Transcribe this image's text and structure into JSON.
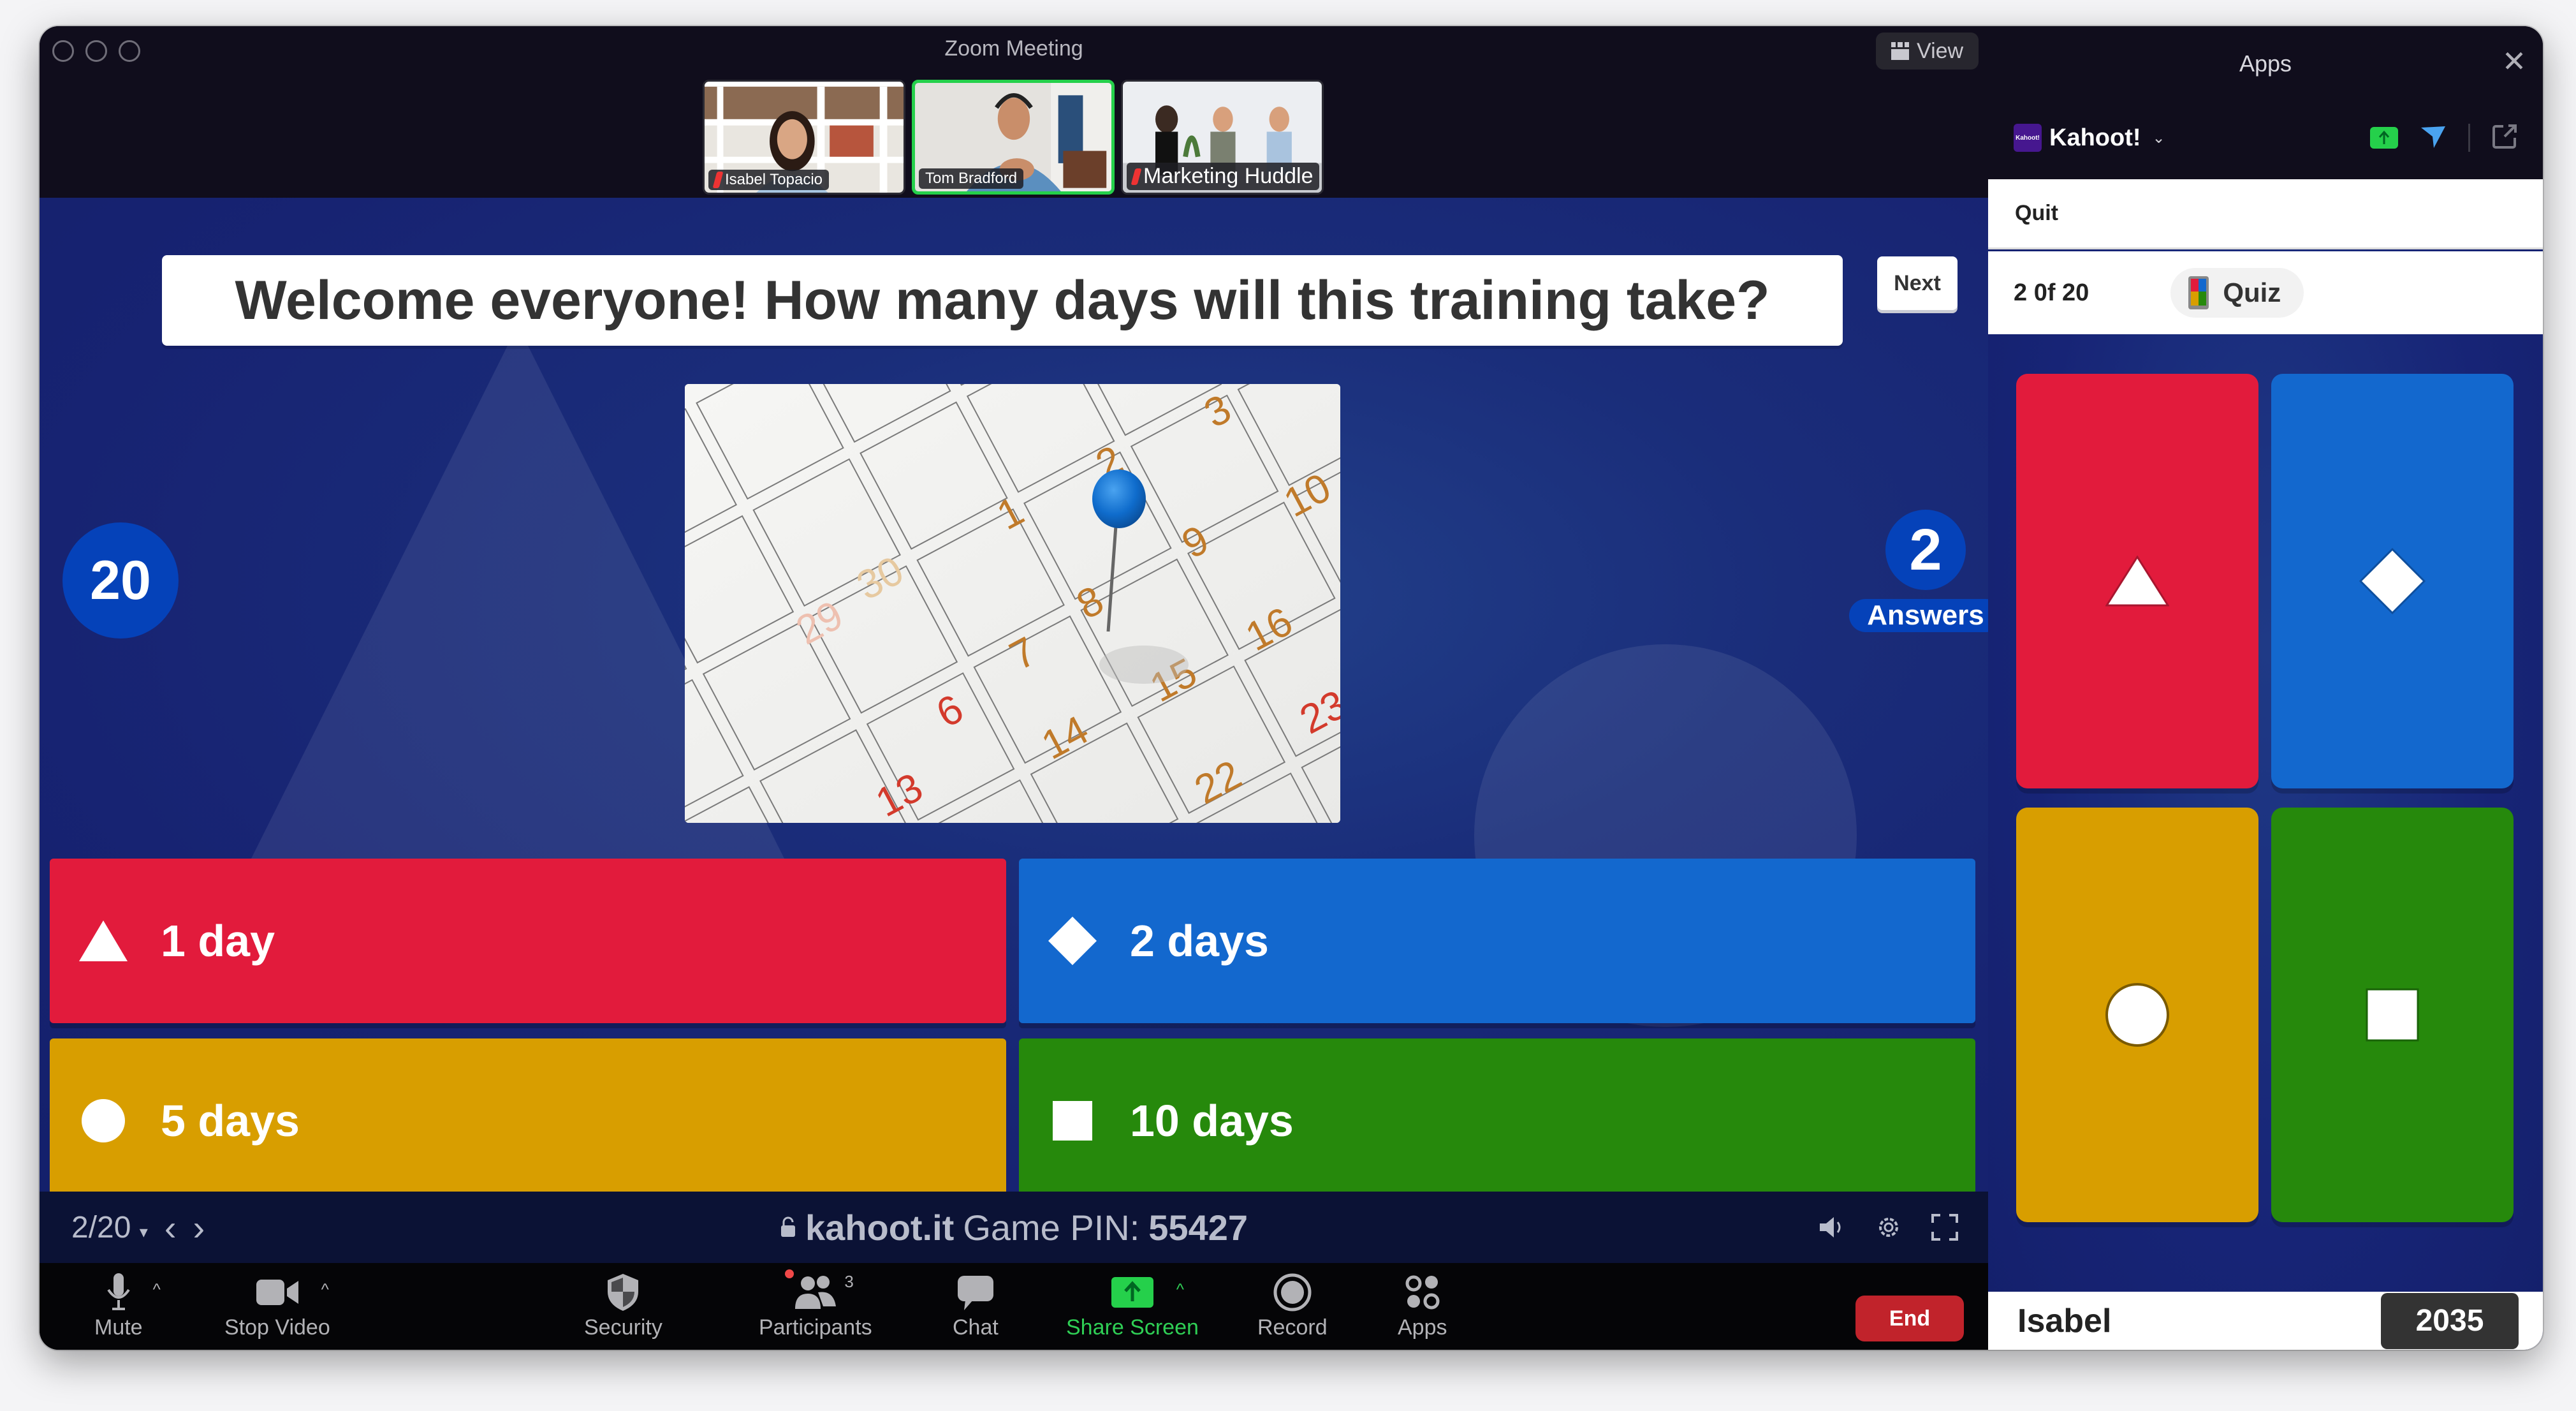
{
  "window": {
    "title": "Zoom Meeting",
    "view_button": "View"
  },
  "participants": [
    {
      "name": "Isabel Topacio",
      "muted": true,
      "active": false
    },
    {
      "name": "Tom Bradford",
      "muted": false,
      "active": true
    },
    {
      "name": "Marketing Huddle",
      "muted": true,
      "active": false
    }
  ],
  "kahoot": {
    "question": "Welcome everyone! How many days will this training take?",
    "next_label": "Next",
    "timer": "20",
    "answers_count": "2",
    "answers_label": "Answers",
    "image_alt": "calendar with blue push pin",
    "calendar_numbers": [
      "3",
      "2",
      "10",
      "1",
      "9",
      "30",
      "29",
      "8",
      "7",
      "16",
      "6",
      "15",
      "14",
      "23",
      "22",
      "13"
    ],
    "options": [
      {
        "shape": "triangle",
        "label": "1 day",
        "color": "#e21b3c"
      },
      {
        "shape": "diamond",
        "label": "2 days",
        "color": "#1368ce"
      },
      {
        "shape": "circle",
        "label": "5 days",
        "color": "#d89e00"
      },
      {
        "shape": "square",
        "label": "10 days",
        "color": "#26890c"
      }
    ],
    "footer": {
      "pager": "2/20",
      "site": "kahoot.it",
      "pin_label": "Game PIN:",
      "pin": "55427"
    }
  },
  "toolbar": {
    "mute": "Mute",
    "stop_video": "Stop Video",
    "security": "Security",
    "participants": "Participants",
    "participants_count": "3",
    "chat": "Chat",
    "share_screen": "Share Screen",
    "record": "Record",
    "apps": "Apps",
    "end": "End"
  },
  "apps_panel": {
    "title": "Apps",
    "app_name": "Kahoot!",
    "app_logo_text": "Kahoot!",
    "quit_label": "Quit",
    "progress": "2 0f 20",
    "quiz_type": "Quiz",
    "player_name": "Isabel",
    "player_score": "2035"
  },
  "colors": {
    "red": "#e21b3c",
    "blue": "#1368ce",
    "yellow": "#d89e00",
    "green": "#26890c",
    "kahoot_purple": "#46178f",
    "zoom_green": "#25d04b",
    "end_red": "#c1232b"
  }
}
